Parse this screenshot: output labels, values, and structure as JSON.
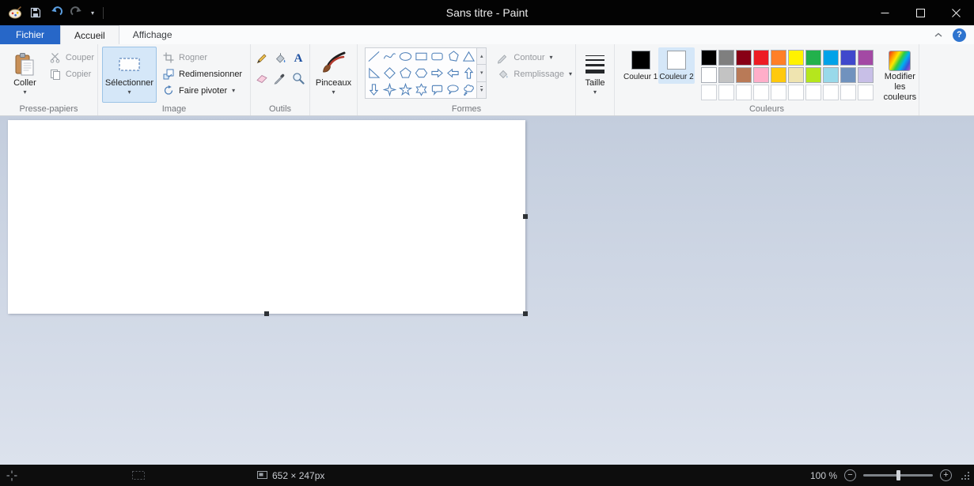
{
  "glyphs": {
    "dropdown": "▾",
    "up": "▴",
    "more": "▾",
    "minus": "−",
    "plus": "+"
  },
  "titlebar": {
    "title": "Sans titre - Paint"
  },
  "tabs": {
    "file": "Fichier",
    "home": "Accueil",
    "view": "Affichage"
  },
  "ribbon": {
    "clipboard": {
      "label": "Presse-papiers",
      "paste": "Coller",
      "cut": "Couper",
      "copy": "Copier"
    },
    "image": {
      "label": "Image",
      "select": "Sélectionner",
      "crop": "Rogner",
      "resize": "Redimensionner",
      "rotate": "Faire pivoter"
    },
    "tools": {
      "label": "Outils",
      "items": [
        "pencil-icon",
        "fill-icon",
        "text-icon",
        "eraser-icon",
        "color-picker-icon",
        "magnifier-icon"
      ]
    },
    "brushes": {
      "label": "Pinceaux"
    },
    "shapes": {
      "label": "Formes",
      "outline": "Contour",
      "fill": "Remplissage",
      "items": [
        "line",
        "curve",
        "oval",
        "rectangle",
        "rounded-rectangle",
        "polygon",
        "triangle",
        "right-triangle",
        "diamond",
        "pentagon",
        "hexagon",
        "arrow-right",
        "arrow-left",
        "arrow-up",
        "arrow-down",
        "star-4",
        "star-5",
        "star-6",
        "callout-rounded",
        "callout-oval",
        "callout-cloud"
      ]
    },
    "size": {
      "label": "Taille"
    },
    "colors": {
      "label": "Couleurs",
      "color1_label": "Couleur 1",
      "color1": "#000000",
      "color2_label": "Couleur 2",
      "color2": "#ffffff",
      "edit_label": "Modifier les couleurs",
      "palette_rows": [
        [
          "#000000",
          "#7f7f7f",
          "#880015",
          "#ed1c24",
          "#ff7f27",
          "#fff200",
          "#22b14c",
          "#00a2e8",
          "#3f48cc",
          "#a349a4"
        ],
        [
          "#ffffff",
          "#c3c3c3",
          "#b97a57",
          "#ffaec9",
          "#ffc90e",
          "#efe4b0",
          "#b5e61d",
          "#99d9ea",
          "#7092be",
          "#c8bfe7"
        ],
        [
          null,
          null,
          null,
          null,
          null,
          null,
          null,
          null,
          null,
          null
        ]
      ]
    }
  },
  "canvas": {
    "status_size": "652 × 247px"
  },
  "statusbar": {
    "zoom": "100 %"
  },
  "icons": {
    "quick_access": [
      "paint-app-icon",
      "save-icon",
      "undo-icon",
      "redo-icon",
      "qat-dropdown-icon"
    ],
    "window_controls": [
      "minimize-icon",
      "maximize-icon",
      "close-icon"
    ],
    "status_left": [
      "cursor-position-icon",
      "selection-size-icon",
      "image-size-icon"
    ],
    "status_right": [
      "zoom-out-icon",
      "zoom-slider",
      "zoom-in-icon",
      "resize-grip-icon"
    ]
  }
}
